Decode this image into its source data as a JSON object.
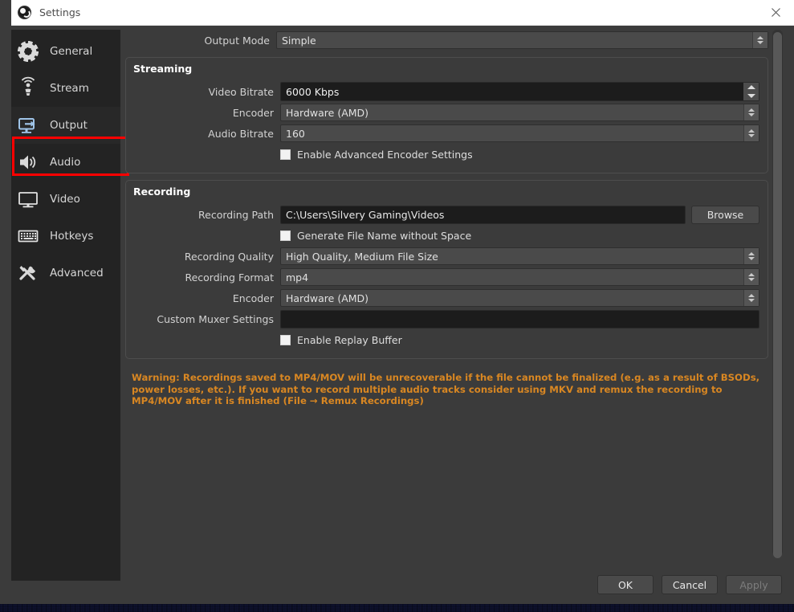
{
  "window": {
    "title": "Settings",
    "logo_icon": "obs-logo-icon",
    "close_icon": "close-icon"
  },
  "sidebar": {
    "items": [
      {
        "label": "General",
        "icon": "gear-icon",
        "selected": false
      },
      {
        "label": "Stream",
        "icon": "broadcast-icon",
        "selected": false
      },
      {
        "label": "Output",
        "icon": "output-icon",
        "selected": true
      },
      {
        "label": "Audio",
        "icon": "speaker-icon",
        "selected": false
      },
      {
        "label": "Video",
        "icon": "monitor-icon",
        "selected": false
      },
      {
        "label": "Hotkeys",
        "icon": "keyboard-icon",
        "selected": false
      },
      {
        "label": "Advanced",
        "icon": "tools-icon",
        "selected": false
      }
    ],
    "highlight_color": "#ff0000"
  },
  "content": {
    "output_mode": {
      "label": "Output Mode",
      "value": "Simple"
    },
    "streaming": {
      "title": "Streaming",
      "video_bitrate": {
        "label": "Video Bitrate",
        "value": "6000 Kbps"
      },
      "encoder": {
        "label": "Encoder",
        "value": "Hardware (AMD)"
      },
      "audio_bitrate": {
        "label": "Audio Bitrate",
        "value": "160"
      },
      "advanced_encoder": {
        "label": "Enable Advanced Encoder Settings",
        "checked": false
      }
    },
    "recording": {
      "title": "Recording",
      "recording_path": {
        "label": "Recording Path",
        "value": "C:\\Users\\Silvery Gaming\\Videos",
        "browse_label": "Browse"
      },
      "no_space_filename": {
        "label": "Generate File Name without Space",
        "checked": false
      },
      "recording_quality": {
        "label": "Recording Quality",
        "value": "High Quality, Medium File Size"
      },
      "recording_format": {
        "label": "Recording Format",
        "value": "mp4"
      },
      "encoder": {
        "label": "Encoder",
        "value": "Hardware (AMD)"
      },
      "custom_muxer": {
        "label": "Custom Muxer Settings",
        "value": "",
        "placeholder": ""
      },
      "replay_buffer": {
        "label": "Enable Replay Buffer",
        "checked": false
      }
    },
    "warning": "Warning: Recordings saved to MP4/MOV will be unrecoverable if the file cannot be finalized (e.g. as a result of BSODs, power losses, etc.). If you want to record multiple audio tracks consider using MKV and remux the recording to MP4/MOV after it is finished (File → Remux Recordings)",
    "warning_color": "#d98722"
  },
  "footer": {
    "ok_label": "OK",
    "cancel_label": "Cancel",
    "apply_label": "Apply",
    "apply_disabled": true
  }
}
